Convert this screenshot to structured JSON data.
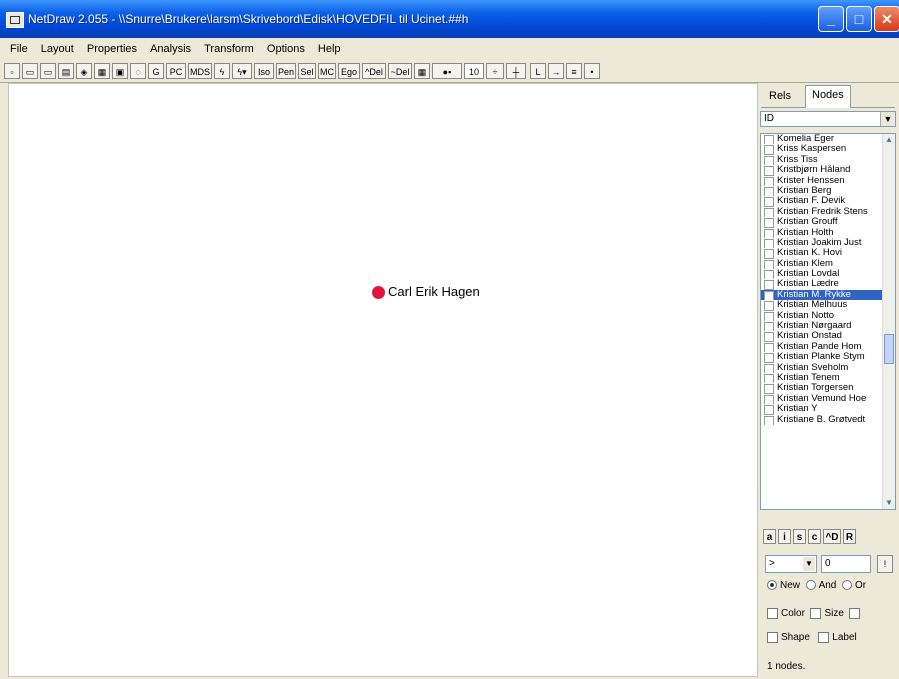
{
  "window": {
    "title": "NetDraw 2.055 - \\\\Snurre\\Brukere\\larsm\\Skrivebord\\Edisk\\HOVEDFIL til Ucinet.##h",
    "controls": {
      "minimize": "_",
      "maximize": "□",
      "close": "✕"
    }
  },
  "menu": [
    "File",
    "Layout",
    "Properties",
    "Analysis",
    "Transform",
    "Options",
    "Help"
  ],
  "toolbar": {
    "g": "G",
    "pc": "PC",
    "mds": "MDS",
    "iso": "Iso",
    "pen": "Pen",
    "sel": "Sel",
    "mc": "MC",
    "ego": "Ego",
    "del1": "^Del",
    "del2": "~Del",
    "num": "10",
    "l": "L"
  },
  "graph": {
    "node_label": "Carl Erik Hagen",
    "node_color": "#e1163c"
  },
  "panel": {
    "tabs": [
      "Rels",
      "Nodes"
    ],
    "attribute_select": "ID",
    "nodes": [
      "Komelia Eger",
      "Kriss Kaspersen",
      "Kriss Tiss",
      "Kristbjørn Håland",
      "Krister Henssen",
      "Kristian Berg",
      "Kristian F. Devik",
      "Kristian Fredrik Stens",
      "Kristian Grouff",
      "Kristian Holth",
      "Kristian Joakim Just",
      "Kristian K. Hovi",
      "Kristian Klem",
      "Kristian Lovdal",
      "Kristian Lædre",
      "Kristian M. Rykke",
      "Kristian Melhuus",
      "Kristian Notto",
      "Kristian Nørgaard",
      "Kristian Onstad",
      "Kristian Pande Hom",
      "Kristian Planke Stym",
      "Kristian Sveholm",
      "Kristian Tenem",
      "Kristian Torgersen",
      "Kristian Vemund Hoe",
      "Kristian Y",
      "Kristiane B. Grøtvedt"
    ],
    "selected_index": 15,
    "letter_buttons": [
      "a",
      "i",
      "s",
      "c",
      "^D",
      "R"
    ],
    "filter_operator": ">",
    "filter_value": "0",
    "filter_go": "!",
    "radio": {
      "new": "New",
      "and": "And",
      "or": "Or"
    },
    "check": {
      "color": "Color",
      "size": "Size",
      "shape": "Shape",
      "label": "Label"
    },
    "status": "1 nodes."
  }
}
